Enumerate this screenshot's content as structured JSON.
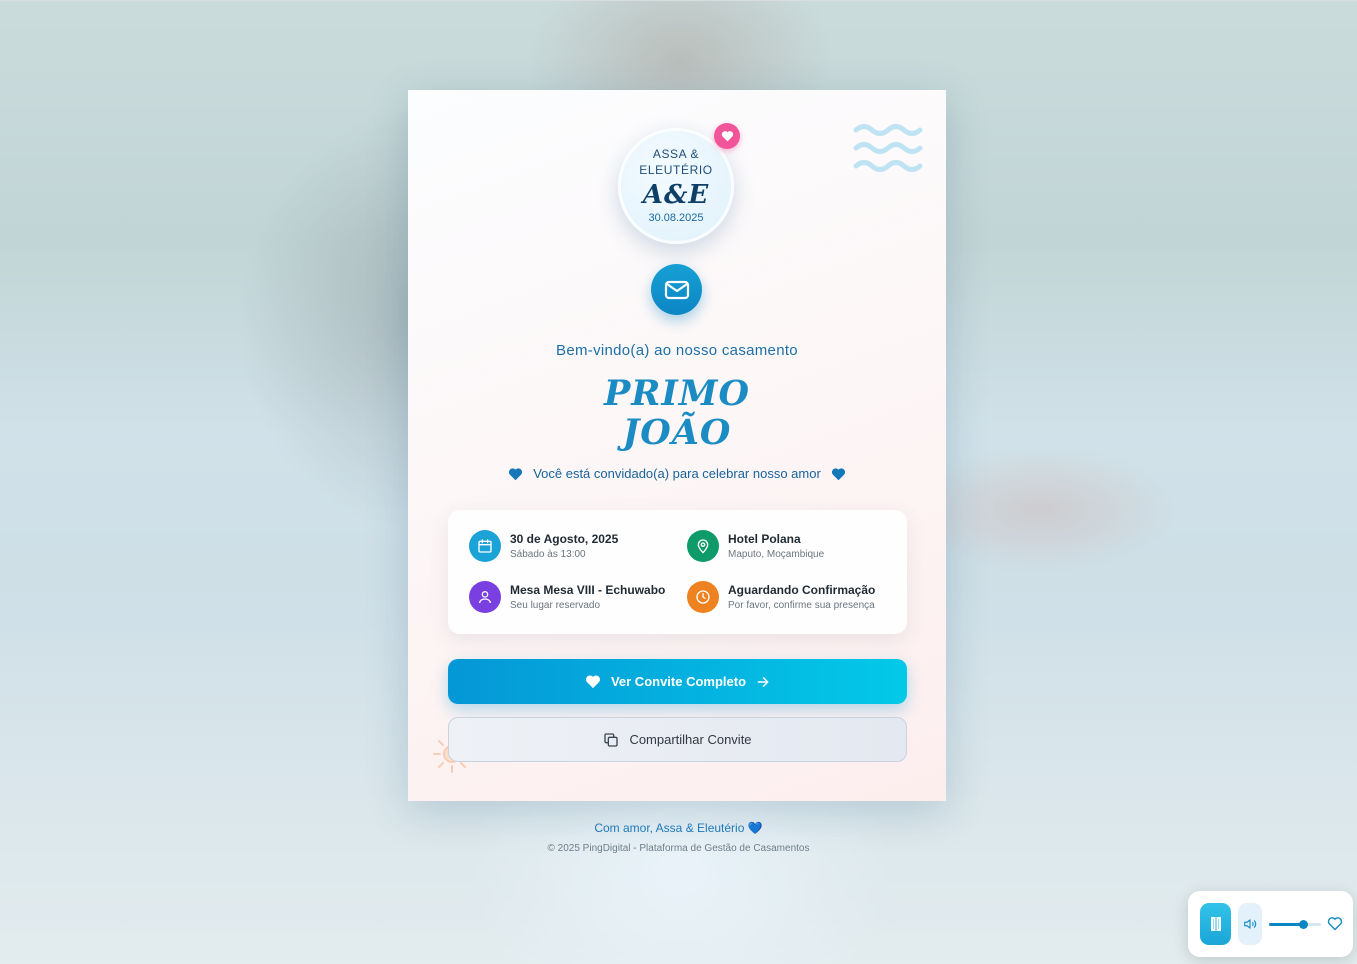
{
  "monogram": {
    "names_line1": "ASSA &",
    "names_line2": "ELEUTÉRIO",
    "initials": "A&E",
    "date": "30.08.2025"
  },
  "welcome": "Bem-vindo(a) ao nosso casamento",
  "guest": {
    "line1": "PRIMO",
    "line2": "JOÃO"
  },
  "invite_message": "Você está convidado(a) para celebrar nosso amor",
  "details": {
    "date": {
      "title": "30 de Agosto, 2025",
      "subtitle": "Sábado às 13:00",
      "icon": "calendar-icon",
      "color": "#1ba3d8"
    },
    "venue": {
      "title": "Hotel Polana",
      "subtitle": "Maputo, Moçambique",
      "icon": "map-pin-icon",
      "color": "#0f9a6a"
    },
    "table": {
      "title": "Mesa Mesa VIII - Echuwabo",
      "subtitle": "Seu lugar reservado",
      "icon": "user-icon",
      "color": "#7a3fe0"
    },
    "status": {
      "title": "Aguardando Confirmação",
      "subtitle": "Por favor, confirme sua presença",
      "icon": "clock-icon",
      "color": "#ee8220"
    }
  },
  "buttons": {
    "view_invite": "Ver Convite Completo",
    "share_invite": "Compartilhar Convite"
  },
  "footer": {
    "signature": "Com amor, Assa & Eleutério 💙",
    "copyright": "© 2025 PingDigital - Plataforma de Gestão de Casamentos"
  },
  "player": {
    "state": "playing",
    "volume": 0.65
  },
  "colors": {
    "accent": "#0b86c4",
    "heart_badge": "#f2549a"
  }
}
